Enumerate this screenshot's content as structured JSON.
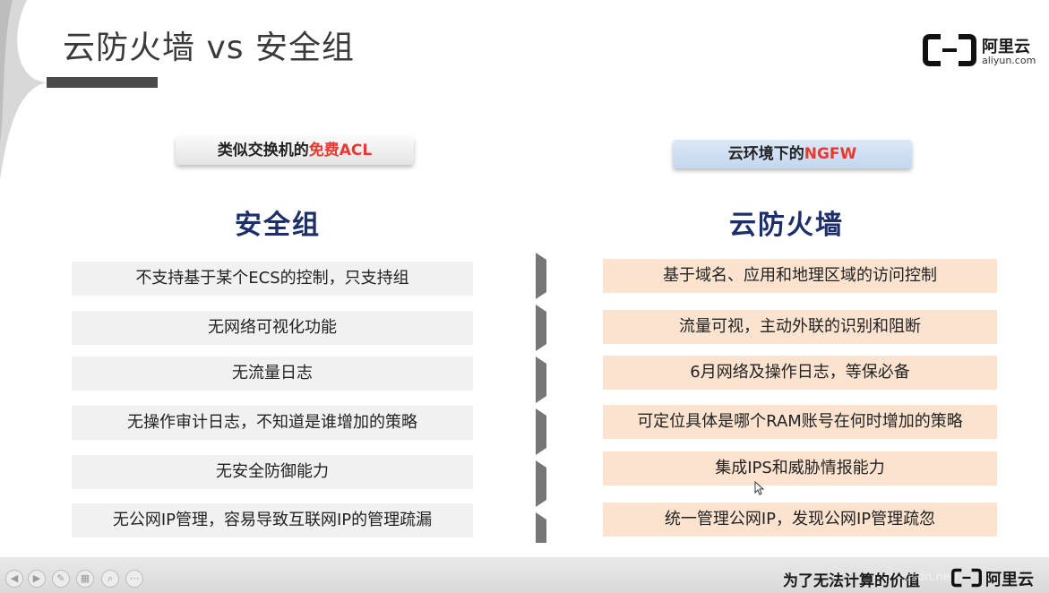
{
  "slide": {
    "title": "云防火墙 vs 安全组",
    "logo": {
      "cn": "阿里云",
      "en": "aliyun.com"
    }
  },
  "left": {
    "tag_prefix": "类似交换机的",
    "tag_highlight": "免费ACL",
    "heading": "安全组",
    "items": [
      "不支持基于某个ECS的控制，只支持组",
      "无网络可视化功能",
      "无流量日志",
      "无操作审计日志，不知道是谁增加的策略",
      "无安全防御能力",
      "无公网IP管理，容易导致互联网IP的管理疏漏"
    ]
  },
  "right": {
    "tag_prefix": "云环境下的",
    "tag_highlight": "NGFW",
    "heading": "云防火墙",
    "items": [
      "基于域名、应用和地理区域的访问控制",
      "流量可视，主动外联的识别和阻断",
      "6月网络及操作日志，等保必备",
      "可定位具体是哪个RAM账号在何时增加的策略",
      "集成IPS和威胁情报能力",
      "统一管理公网IP，发现公网IP管理疏忽"
    ]
  },
  "footer": {
    "slogan": "为了无法计算的价值",
    "logo_cn": "阿里云",
    "watermark": "csdn.net/..."
  },
  "controls": [
    "prev-icon",
    "next-icon",
    "pen-icon",
    "slides-icon",
    "zoom-icon",
    "more-icon"
  ],
  "colors": {
    "heading": "#1d2f6a",
    "highlight": "#e8392f",
    "left_row_bg": "#f1f1f1",
    "right_row_bg": "#fbe3cf",
    "right_tag_bg": "#c4d7ef"
  }
}
